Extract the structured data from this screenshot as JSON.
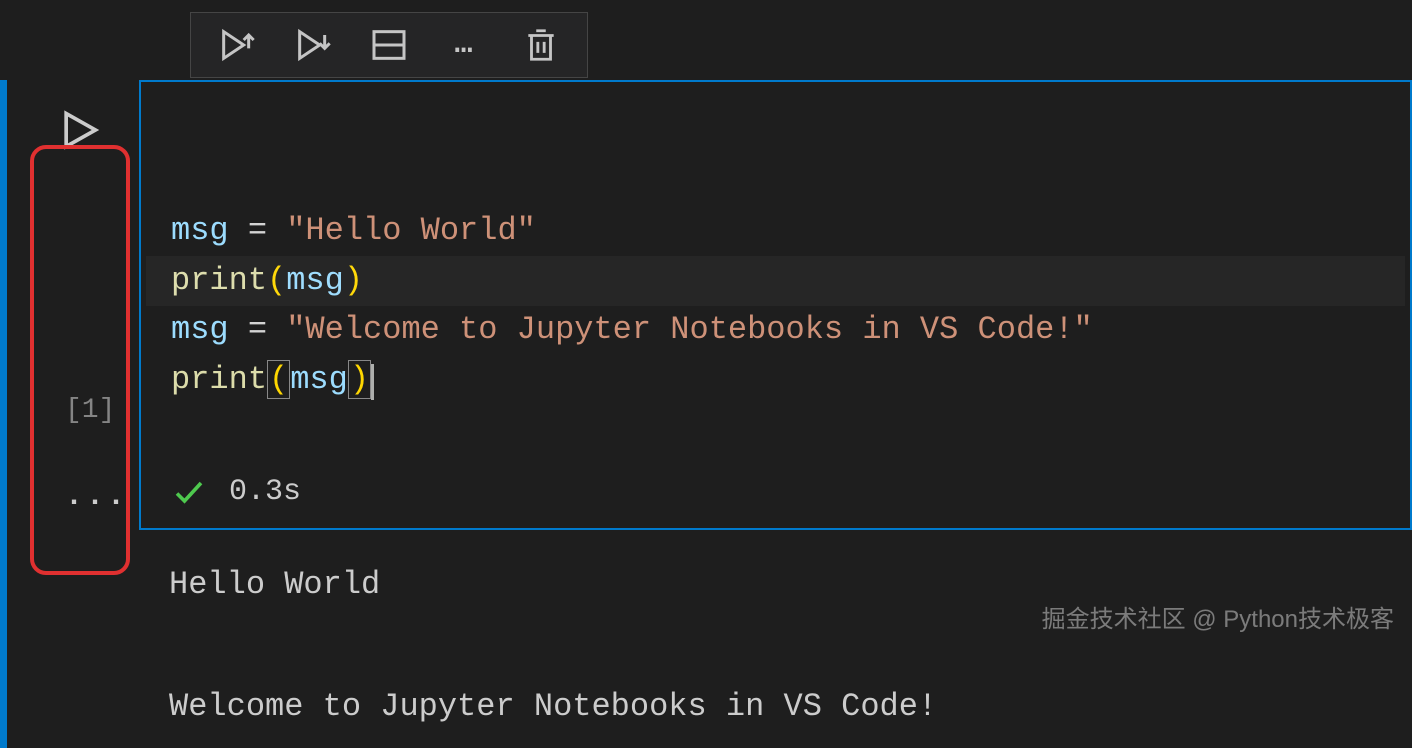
{
  "toolbar": {
    "run_above": "run-cells-above-icon",
    "run_below": "run-cell-and-below-icon",
    "split": "split-cell-icon",
    "more": "…",
    "delete": "delete-cell-icon"
  },
  "cell": {
    "exec_count": "[1]",
    "collapse": "...",
    "code": {
      "line1": {
        "var": "msg",
        "op": " = ",
        "str": "\"Hello World\""
      },
      "line2": {
        "fn": "print",
        "lp": "(",
        "arg": "msg",
        "rp": ")"
      },
      "line3": {
        "var": "msg",
        "op": " = ",
        "str": "\"Welcome to Jupyter Notebooks in VS Code!\""
      },
      "line4": {
        "fn": "print",
        "lp": "(",
        "arg": "msg",
        "rp": ")"
      }
    },
    "status": {
      "check": "✓",
      "time": "0.3s"
    },
    "output_line1": "Hello World",
    "output_line2": "Welcome to Jupyter Notebooks in VS Code!"
  },
  "watermark": "掘金技术社区 @ Python技术极客"
}
